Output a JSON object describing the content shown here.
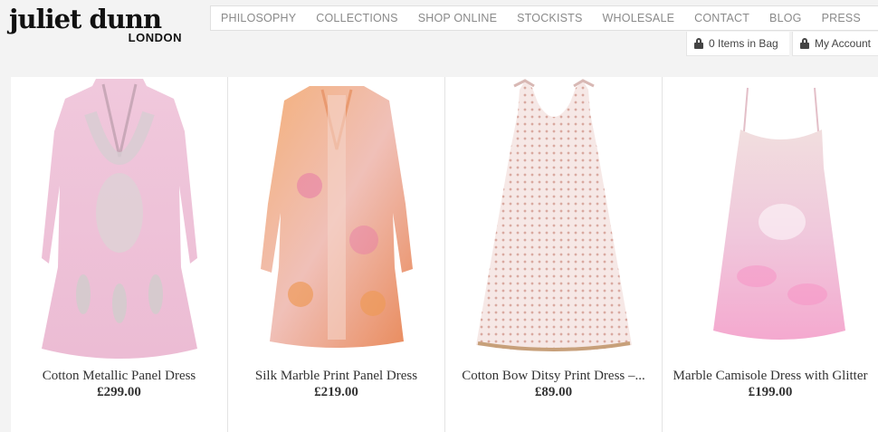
{
  "brand": {
    "name": "juliet dunn",
    "location": "LONDON"
  },
  "nav": [
    "PHILOSOPHY",
    "COLLECTIONS",
    "SHOP ONLINE",
    "STOCKISTS",
    "WHOLESALE",
    "CONTACT",
    "BLOG",
    "PRESS"
  ],
  "account_bar": {
    "bag_label": "0 Items in Bag",
    "account_label": "My Account"
  },
  "products": [
    {
      "name": "Cotton Metallic Panel Dress",
      "price": "£299.00",
      "image_icon": "pink-embroidered-dress-image"
    },
    {
      "name": "Silk Marble Print Panel Dress",
      "price": "£219.00",
      "image_icon": "orange-marble-dress-image"
    },
    {
      "name": "Cotton Bow Ditsy Print Dress –...",
      "price": "£89.00",
      "image_icon": "ditsy-print-dress-image"
    },
    {
      "name": "Marble Camisole Dress with Glitter",
      "price": "£199.00",
      "image_icon": "pink-camisole-dress-image"
    }
  ],
  "colors": {
    "nav_text": "#8a8a8a",
    "background": "#f3f3f3",
    "card_bg": "#ffffff"
  }
}
